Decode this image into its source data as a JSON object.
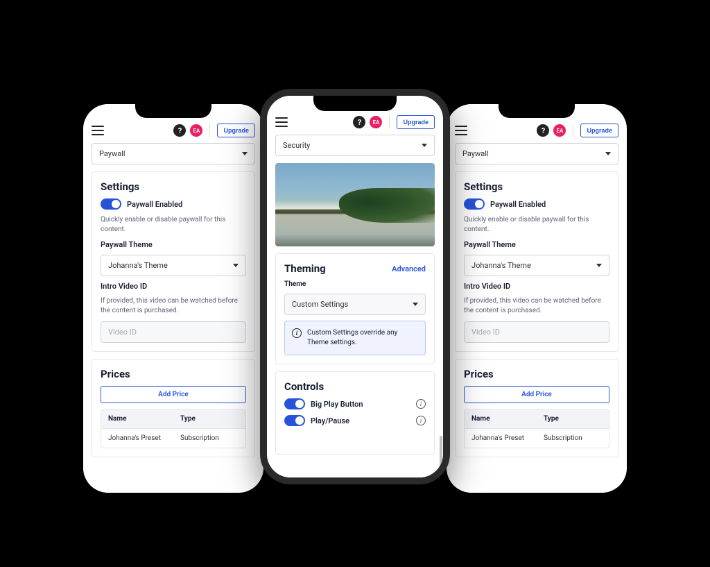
{
  "header": {
    "avatar_initials": "EA",
    "upgrade_label": "Upgrade"
  },
  "paywall_screen": {
    "page_select": "Paywall",
    "settings_title": "Settings",
    "enabled_label": "Paywall Enabled",
    "enabled_help": "Quickly enable or disable paywall for this content.",
    "theme_label": "Paywall Theme",
    "theme_value": "Johanna's Theme",
    "intro_label": "Intro Video ID",
    "intro_help": "If provided, this video can be watched before the content is purchased.",
    "intro_placeholder": "Video ID",
    "prices_title": "Prices",
    "add_price_label": "Add Price",
    "table": {
      "col_name": "Name",
      "col_type": "Type",
      "rows": [
        {
          "name": "Johanna's Preset",
          "type": "Subscription"
        }
      ]
    }
  },
  "theming_screen": {
    "page_select": "Security",
    "theming_title": "Theming",
    "advanced_label": "Advanced",
    "theme_label": "Theme",
    "theme_value": "Custom Settings",
    "info_text": "Custom Settings override any Theme settings.",
    "controls_title": "Controls",
    "controls": [
      {
        "label": "Big Play Button",
        "on": true
      },
      {
        "label": "Play/Pause",
        "on": true
      }
    ]
  }
}
